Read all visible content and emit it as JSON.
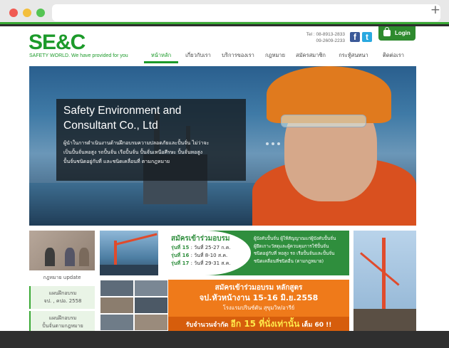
{
  "logo": {
    "text": "SE&C",
    "tagline": "SAFETY WORLD.  We have provided for you"
  },
  "contact": {
    "tel_label": "Tel : 08-8913-2833",
    "tel2": "09-2609-2233"
  },
  "social": {
    "facebook": "f",
    "twitter": "t"
  },
  "login": {
    "label": "Login"
  },
  "nav": {
    "items": [
      {
        "label": "หน้าหลัก",
        "active": true
      },
      {
        "label": "เกี่ยวกับเรา",
        "active": false
      },
      {
        "label": "บริการของเรา",
        "active": false
      },
      {
        "label": "กฎหมาย",
        "active": false
      },
      {
        "label": "สมัครสมาชิก",
        "active": false
      },
      {
        "label": "กระทู้สนทนา",
        "active": false
      },
      {
        "label": "ติดต่อเรา",
        "active": false
      }
    ]
  },
  "hero": {
    "title_line1": "Safety Environment and",
    "title_line2": "Consultant Co., Ltd",
    "body_line1": "ผู้นำในการดำเนินงานด้านฝึกอบรมความปลอดภัยและปั้นจั่น ไม่ว่าจะ",
    "body_line2": "เป็นปั้นจั่นหอสูง รถปั้นจั่น เรือปั้นจั่น ปั้นจั่นเหนือศีรษะ ปั้นจั่นหอสูง",
    "body_line3": "ปั้นจั่นชนิดอยู่กับที่ และชนิดเคลื่อนที่ ตามกฎหมาย"
  },
  "sidebar": {
    "items": [
      {
        "label_line1": "กฎหมาย update",
        "label_line2": ""
      },
      {
        "label_line1": "แผนฝึกอบรม",
        "label_line2": "จป. , คปอ. 2558"
      },
      {
        "label_line1": "แผนฝึกอบรม",
        "label_line2": "ปั้นจั่นตามกฎหมาย"
      }
    ]
  },
  "banner1": {
    "title": "สมัครเข้าร่วมอบรม",
    "rounds": [
      {
        "label": "รุ่นที่ 15",
        "date": ": วันที่ 25-27 ก.ค."
      },
      {
        "label": "รุ่นที่ 16",
        "date": ": วันที่ 8-10 ส.ค."
      },
      {
        "label": "รุ่นที่ 17",
        "date": ": วันที่ 29-31 ส.ค."
      }
    ],
    "desc_line1": "ผู้บังคับปั้นจั่น ผู้ให้สัญญาณแก่ผู้บังคับปั้นจั่น",
    "desc_line2": "ผู้ยึดเกาะวัสดุและผู้ควบคุมการใช้ปั้นจั่น",
    "desc_line3": "ชนิดอยู่กับที่ หอสูง รถ เรือปั้นจั่นและปั้นจั่น",
    "desc_line4": "ชนิดเคลื่อนที่ชนิดอื่น (ตามกฎหมาย)"
  },
  "banner2": {
    "title": "สมัครเข้าร่วมอบรม หลักสูตร",
    "date": "จป.หัวหน้างาน 15-16 มิ.ย.2558",
    "venue": "โรงแรมปรินซ์ตัน สุขุมวิท/อารีย์",
    "band_prefix": "รับจำนวนจำกัด",
    "band_big": "อีก 15 ที่นั่งเท่านั้น",
    "band_suffix": "เต็ม 60 !!"
  },
  "colors": {
    "brand_green": "#1c9a2a",
    "orange": "#ef7a1a"
  }
}
